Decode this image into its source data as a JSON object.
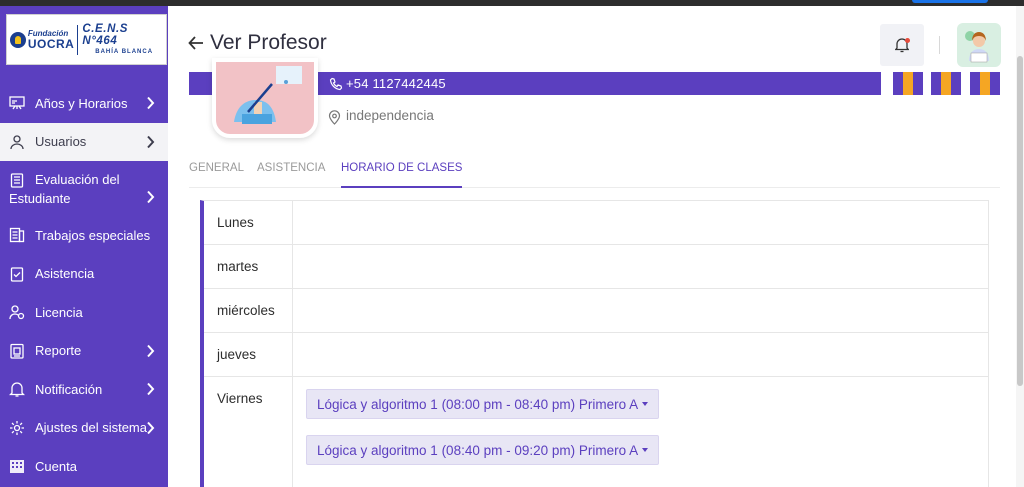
{
  "logo": {
    "fundacion": "Fundación",
    "uocra": "UOCRA",
    "cens": "C.E.N.S N°464",
    "bahia": "BAHÍA BLANCA"
  },
  "sidebar": {
    "items": [
      {
        "label": "Años y Horarios",
        "icon": "easel-icon",
        "chevron": true
      },
      {
        "label": "Usuarios",
        "icon": "user-icon",
        "chevron": true
      },
      {
        "label": "Evaluación del",
        "label2": "Estudiante",
        "icon": "clipboard-list-icon",
        "chevron": true
      },
      {
        "label": "Trabajos especiales",
        "icon": "document-icon",
        "chevron": false
      },
      {
        "label": "Asistencia",
        "icon": "checklist-icon",
        "chevron": false
      },
      {
        "label": "Licencia",
        "icon": "users-icon",
        "chevron": false
      },
      {
        "label": "Reporte",
        "icon": "report-icon",
        "chevron": true
      },
      {
        "label": "Notificación",
        "icon": "bell-icon",
        "chevron": true
      },
      {
        "label": "Ajustes del sistema",
        "icon": "gear-icon",
        "chevron": true
      },
      {
        "label": "Cuenta",
        "icon": "building-icon",
        "chevron": false
      }
    ]
  },
  "header": {
    "title": "Ver Profesor"
  },
  "profile": {
    "phone": "+54  1127442445",
    "location": "independencia"
  },
  "tabs": [
    {
      "label": "GENERAL"
    },
    {
      "label": "ASISTENCIA"
    },
    {
      "label": "HORARIO DE CLASES"
    }
  ],
  "schedule": {
    "days": [
      {
        "name": "Lunes",
        "classes": []
      },
      {
        "name": "martes",
        "classes": []
      },
      {
        "name": "miércoles",
        "classes": []
      },
      {
        "name": "jueves",
        "classes": []
      },
      {
        "name": "Viernes",
        "classes": [
          "Lógica y algoritmo 1 (08:00 pm - 08:40 pm) Primero A",
          "Lógica y algoritmo 1 (08:40 pm - 09:20 pm) Primero A"
        ]
      }
    ]
  },
  "colors": {
    "brand_purple": "#5b3fbf",
    "stripe_orange": "#f5a623",
    "notification_dot": "#e74c3c"
  }
}
